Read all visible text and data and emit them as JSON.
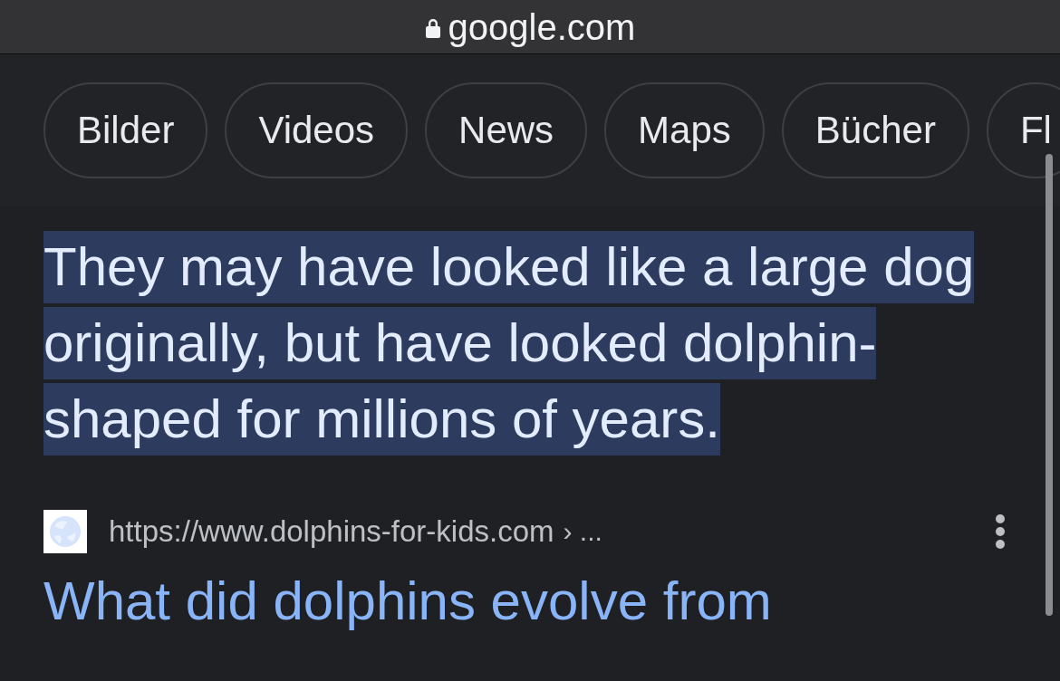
{
  "address_bar": {
    "domain": "google.com",
    "secure": true
  },
  "chips": [
    {
      "label": "Bilder",
      "selected": false
    },
    {
      "label": "Videos",
      "selected": false
    },
    {
      "label": "News",
      "selected": false
    },
    {
      "label": "Maps",
      "selected": false
    },
    {
      "label": "Bücher",
      "selected": false
    },
    {
      "label": "Fl",
      "selected": false
    }
  ],
  "snippet": {
    "text": "They may have looked like a large dog originally, but have looked dolphin-shaped for millions of years.",
    "highlighted": true
  },
  "result": {
    "url": "https://www.dolphins-for-kids.com",
    "breadcrumb": "› ...",
    "title": "What did dolphins evolve from"
  }
}
